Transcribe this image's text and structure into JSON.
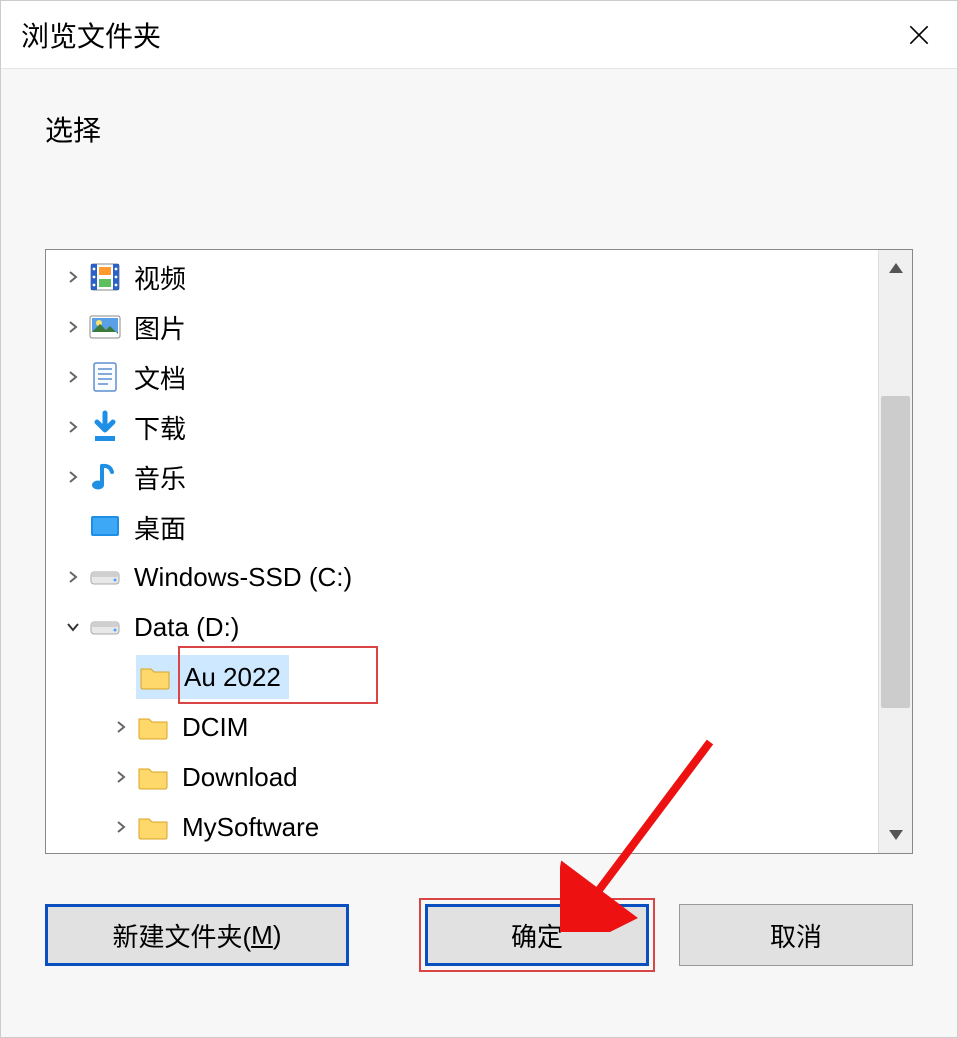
{
  "dialog": {
    "title": "浏览文件夹",
    "instruction": "选择"
  },
  "tree": {
    "items": [
      {
        "label": "视频",
        "icon": "video",
        "depth": 0,
        "expander": "closed"
      },
      {
        "label": "图片",
        "icon": "pictures",
        "depth": 0,
        "expander": "closed"
      },
      {
        "label": "文档",
        "icon": "documents",
        "depth": 0,
        "expander": "closed"
      },
      {
        "label": "下载",
        "icon": "downloads",
        "depth": 0,
        "expander": "closed"
      },
      {
        "label": "音乐",
        "icon": "music",
        "depth": 0,
        "expander": "closed"
      },
      {
        "label": "桌面",
        "icon": "desktop",
        "depth": 0,
        "expander": "none"
      },
      {
        "label": "Windows-SSD (C:)",
        "icon": "drive",
        "depth": 0,
        "expander": "closed"
      },
      {
        "label": "Data (D:)",
        "icon": "drive",
        "depth": 0,
        "expander": "open"
      },
      {
        "label": "Au 2022",
        "icon": "folder",
        "depth": 1,
        "expander": "none",
        "selected": true
      },
      {
        "label": "DCIM",
        "icon": "folder",
        "depth": 1,
        "expander": "closed"
      },
      {
        "label": "Download",
        "icon": "folder",
        "depth": 1,
        "expander": "closed"
      },
      {
        "label": "MySoftware",
        "icon": "folder",
        "depth": 1,
        "expander": "closed"
      }
    ]
  },
  "buttons": {
    "newfolder_prefix": "新建文件夹(",
    "newfolder_key": "M",
    "newfolder_suffix": ")",
    "ok": "确定",
    "cancel": "取消"
  }
}
